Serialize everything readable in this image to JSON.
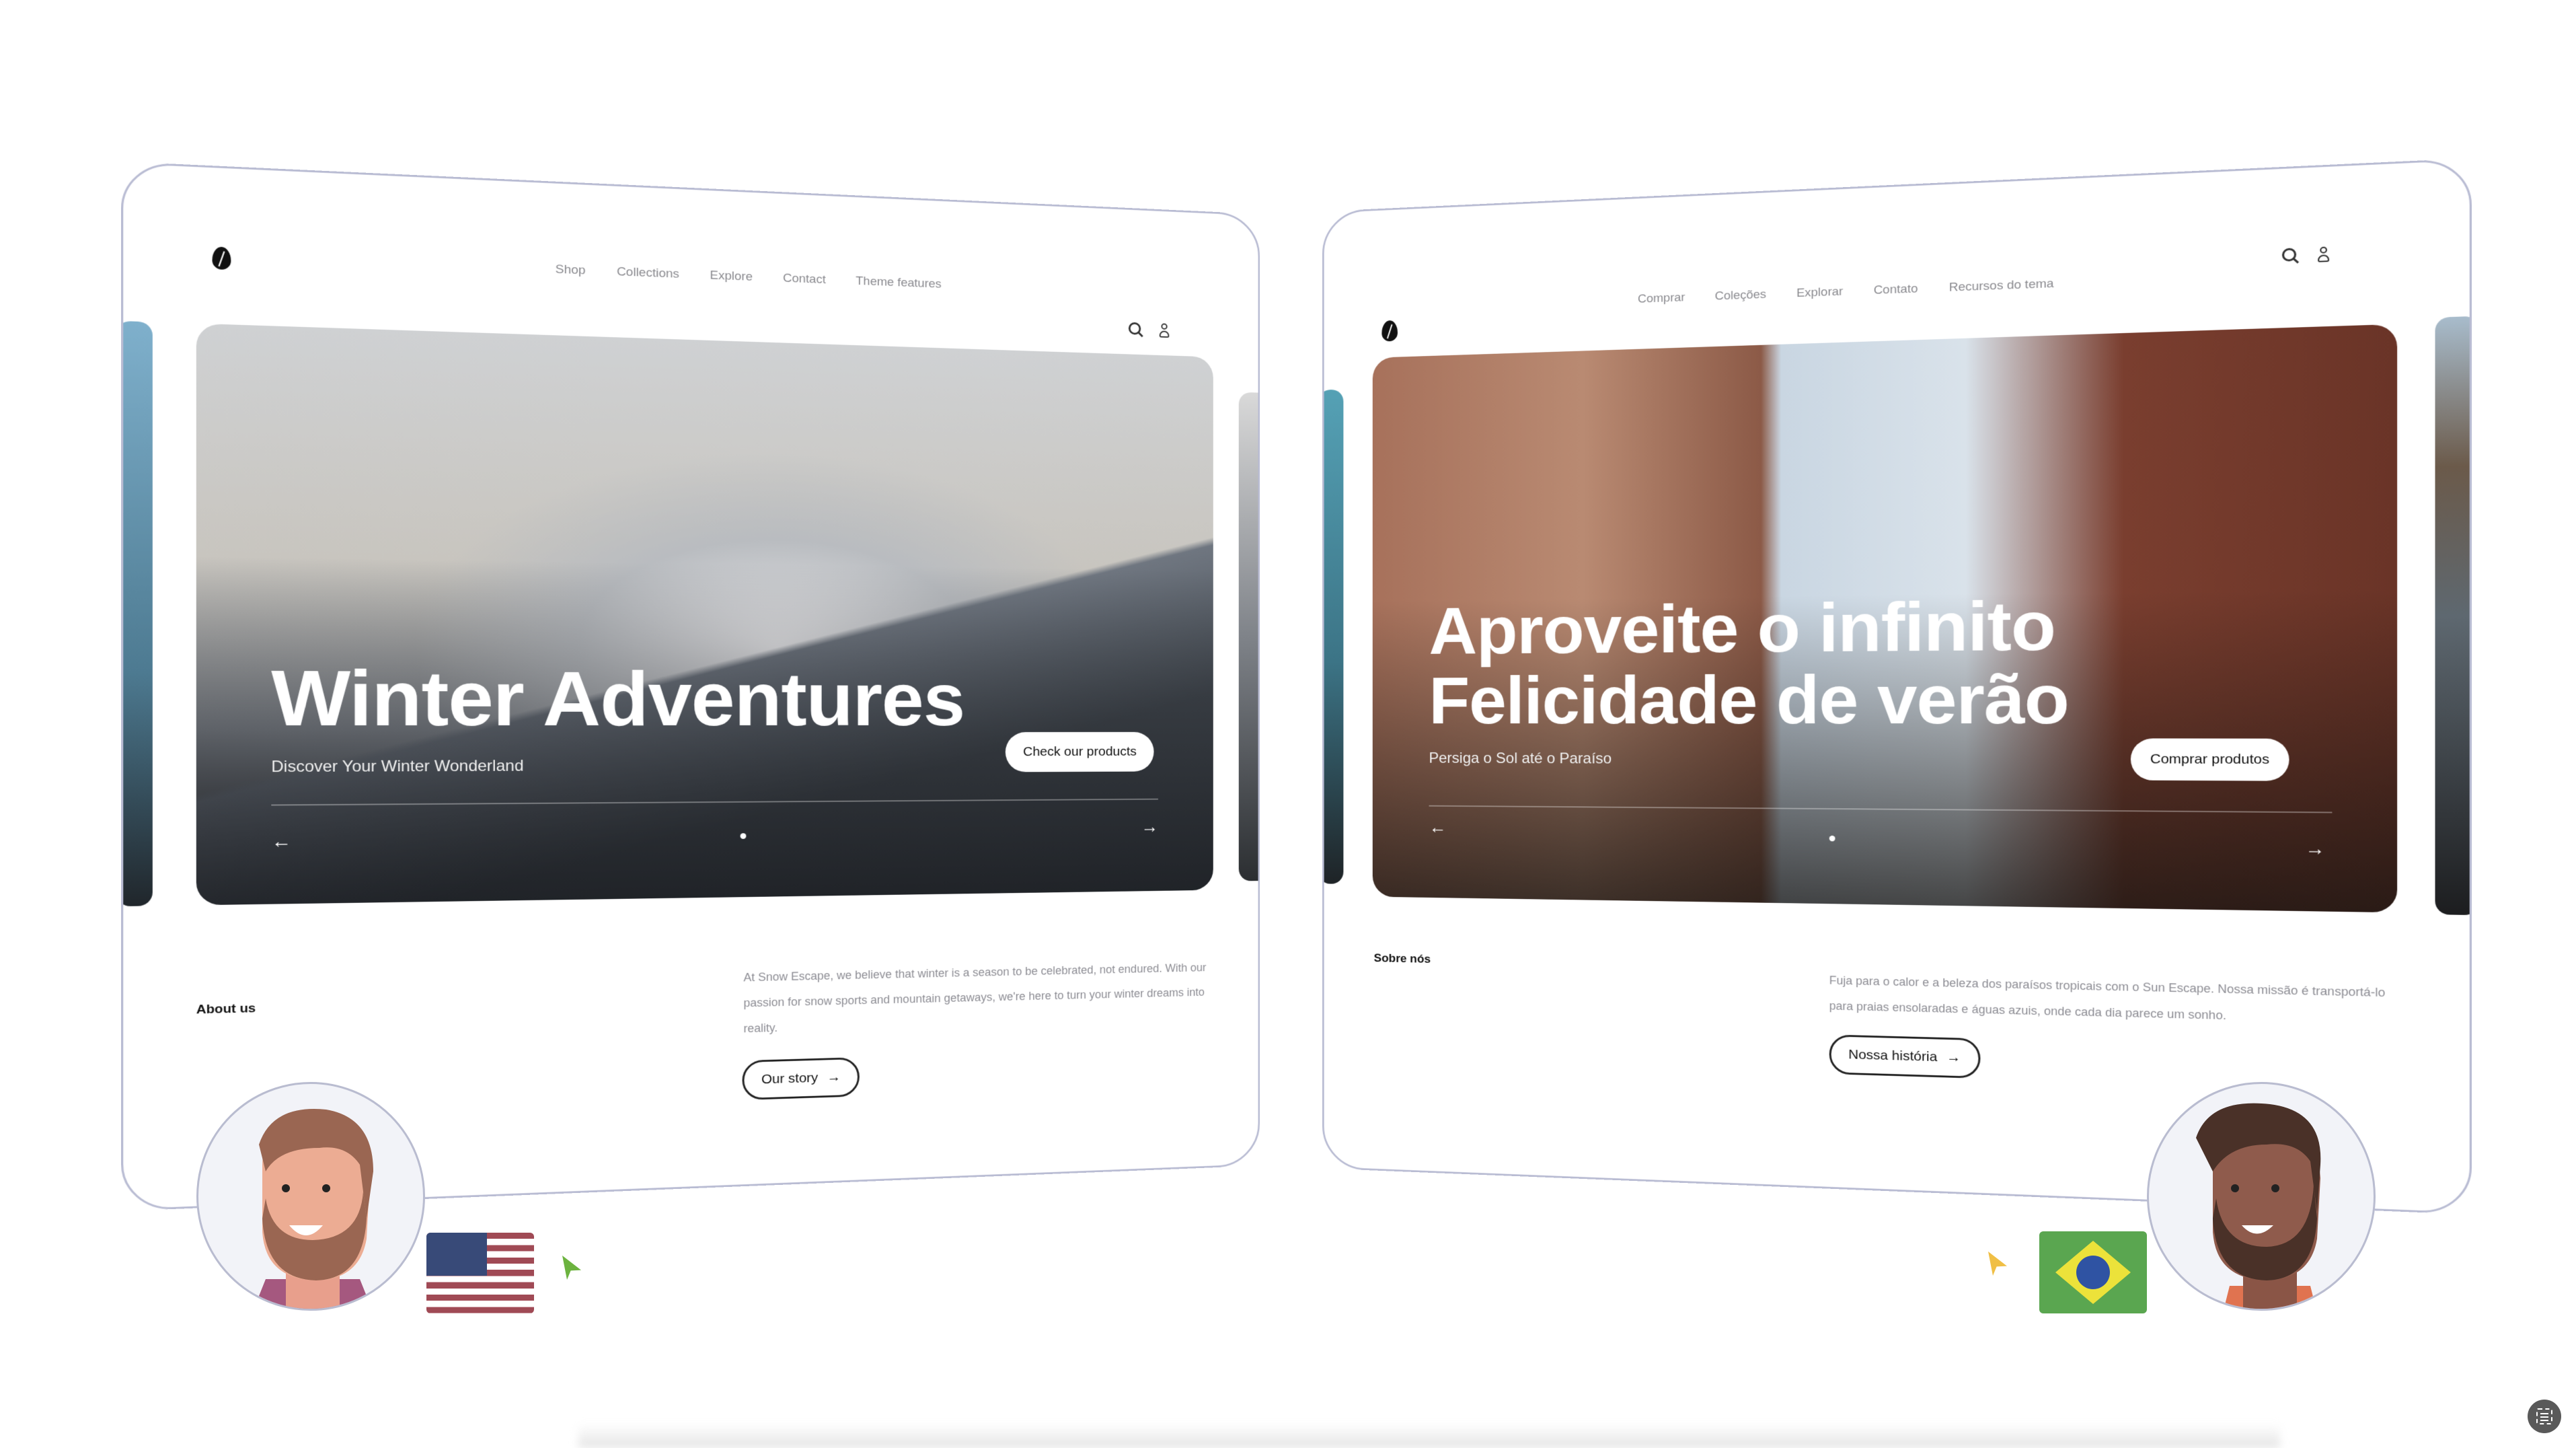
{
  "left_site": {
    "language": "English",
    "nav": [
      "Shop",
      "Collections",
      "Explore",
      "Contact",
      "Theme features"
    ],
    "hero": {
      "title": "Winter Adventures",
      "subtitle": "Discover Your Winter Wonderland",
      "cta": "Check our products",
      "prev_icon": "←",
      "next_icon": "→"
    },
    "about": {
      "label": "About us",
      "text": "At Snow Escape, we believe that winter is a season to be celebrated, not endured. With our passion for snow sports and mountain getaways, we're here to turn your winter dreams into reality.",
      "button": "Our story",
      "button_icon": "→"
    },
    "flag": "us-flag",
    "cursor_color": "#6cb33f"
  },
  "right_site": {
    "language": "Portuguese",
    "nav": [
      "Comprar",
      "Coleções",
      "Explorar",
      "Contato",
      "Recursos do tema"
    ],
    "hero": {
      "title_line1": "Aproveite o infinito",
      "title_line2": "Felicidade de verão",
      "subtitle": "Persiga o Sol até o Paraíso",
      "cta": "Comprar produtos",
      "prev_icon": "←",
      "next_icon": "→"
    },
    "about": {
      "label": "Sobre nós",
      "text": "Fuja para o calor e a beleza dos paraísos tropicais com o Sun Escape. Nossa missão é transportá-lo para praias ensolaradas e águas azuis, onde cada dia parece um sonho.",
      "button": "Nossa história",
      "button_icon": "→"
    },
    "flag": "brazil-flag",
    "cursor_color": "#f0bf45"
  }
}
